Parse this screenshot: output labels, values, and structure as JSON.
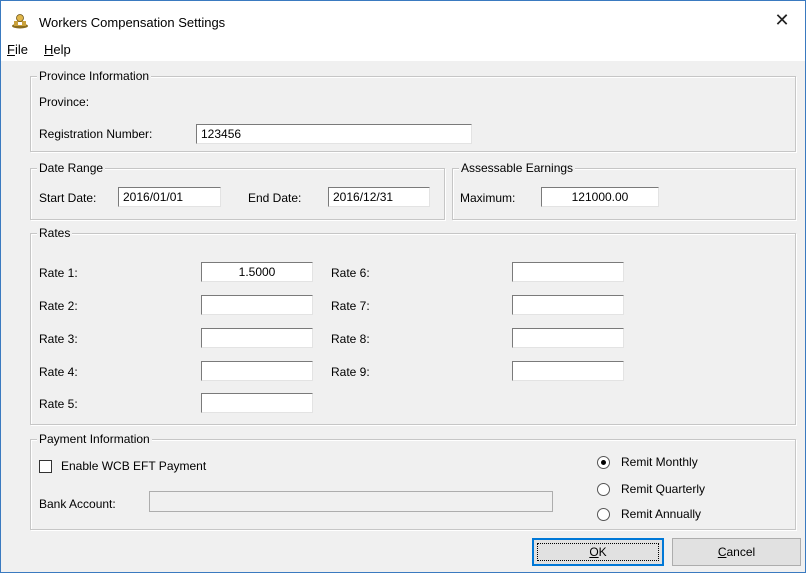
{
  "window": {
    "title": "Workers Compensation Settings",
    "icon": "workers-comp-app-icon",
    "close_glyph": "✕"
  },
  "menu": [
    {
      "mnemonic": "F",
      "rest": "ile"
    },
    {
      "mnemonic": "H",
      "rest": "elp"
    }
  ],
  "province_info": {
    "legend": "Province Information",
    "province_label": "Province:",
    "registration_label": "Registration Number:",
    "registration_value": "123456"
  },
  "date_range": {
    "legend": "Date Range",
    "start_label": "Start Date:",
    "start_value": "2016/01/01",
    "end_label": "End Date:",
    "end_value": "2016/12/31"
  },
  "assessable": {
    "legend": "Assessable Earnings",
    "max_label": "Maximum:",
    "max_value": "121000.00"
  },
  "rates": {
    "legend": "Rates",
    "items": [
      {
        "label": "Rate 1:",
        "value": "1.5000"
      },
      {
        "label": "Rate 2:",
        "value": ""
      },
      {
        "label": "Rate 3:",
        "value": ""
      },
      {
        "label": "Rate 4:",
        "value": ""
      },
      {
        "label": "Rate 5:",
        "value": ""
      },
      {
        "label": "Rate 6:",
        "value": ""
      },
      {
        "label": "Rate 7:",
        "value": ""
      },
      {
        "label": "Rate 8:",
        "value": ""
      },
      {
        "label": "Rate 9:",
        "value": ""
      }
    ]
  },
  "payment": {
    "legend": "Payment Information",
    "eft_label": "Enable WCB EFT Payment",
    "eft_checked": false,
    "bank_label": "Bank Account:",
    "bank_value": "",
    "remit_options": [
      {
        "label": "Remit Monthly",
        "selected": true
      },
      {
        "label": "Remit Quarterly",
        "selected": false
      },
      {
        "label": "Remit Annually",
        "selected": false
      }
    ]
  },
  "buttons": {
    "ok_mnemonic": "O",
    "ok_rest": "K",
    "cancel_mnemonic": "C",
    "cancel_rest": "ancel"
  }
}
